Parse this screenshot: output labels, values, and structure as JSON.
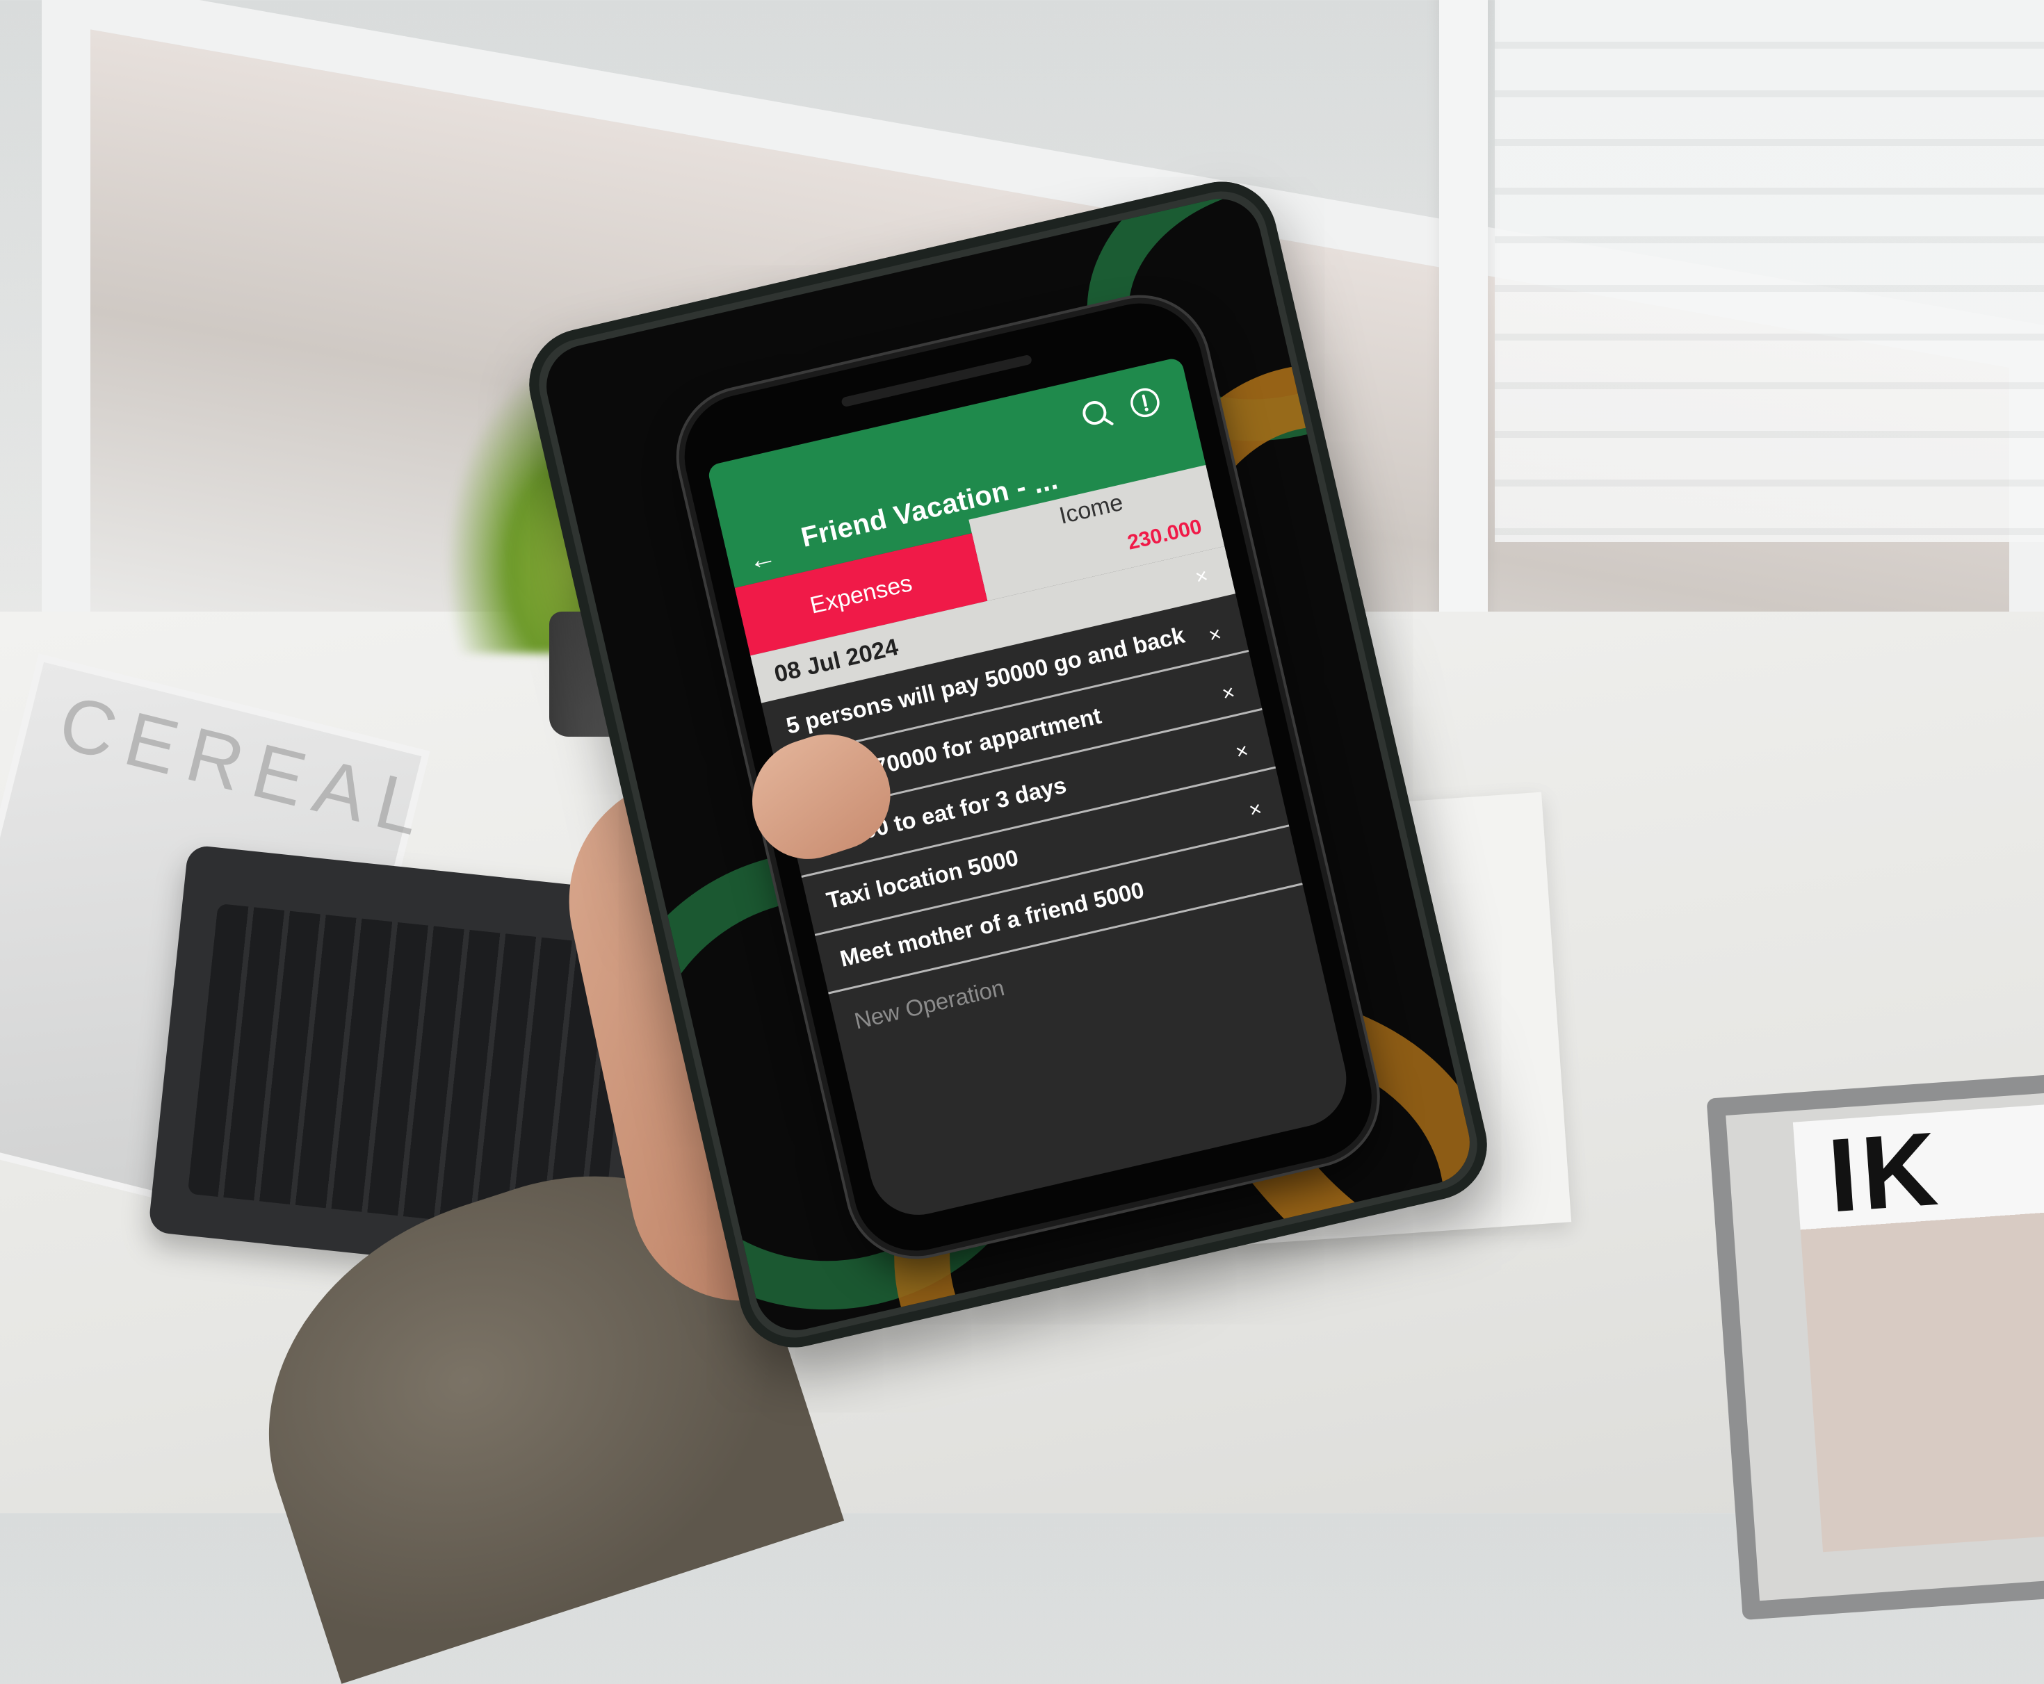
{
  "app": {
    "title": "Friend Vacation - ...",
    "colors": {
      "app_bar": "#1f8a4c",
      "expenses_tab": "#f01a48",
      "total": "#f01a48",
      "background": "#2a2a2a"
    }
  },
  "toolbar": {
    "back_icon": "arrow-left-icon",
    "search_icon": "search-icon",
    "info_icon": "info-icon"
  },
  "tabs": {
    "expenses_label": "Expenses",
    "income_label": "Icome",
    "total": "230.000"
  },
  "list": {
    "date": "08 Jul 2024",
    "items": [
      {
        "text": "5 persons will pay 50000 go and back",
        "delete": "×"
      },
      {
        "text": "House 70000 for appartment",
        "delete": "×"
      },
      {
        "text": "100000 to eat for 3 days",
        "delete": "×"
      },
      {
        "text": "Taxi location 5000",
        "delete": "×"
      },
      {
        "text": "Meet mother of a friend 5000",
        "delete": "×"
      }
    ],
    "new_operation": "New Operation"
  },
  "scene": {
    "magazine_left": "CEREAL",
    "magazine_right": "IK"
  }
}
